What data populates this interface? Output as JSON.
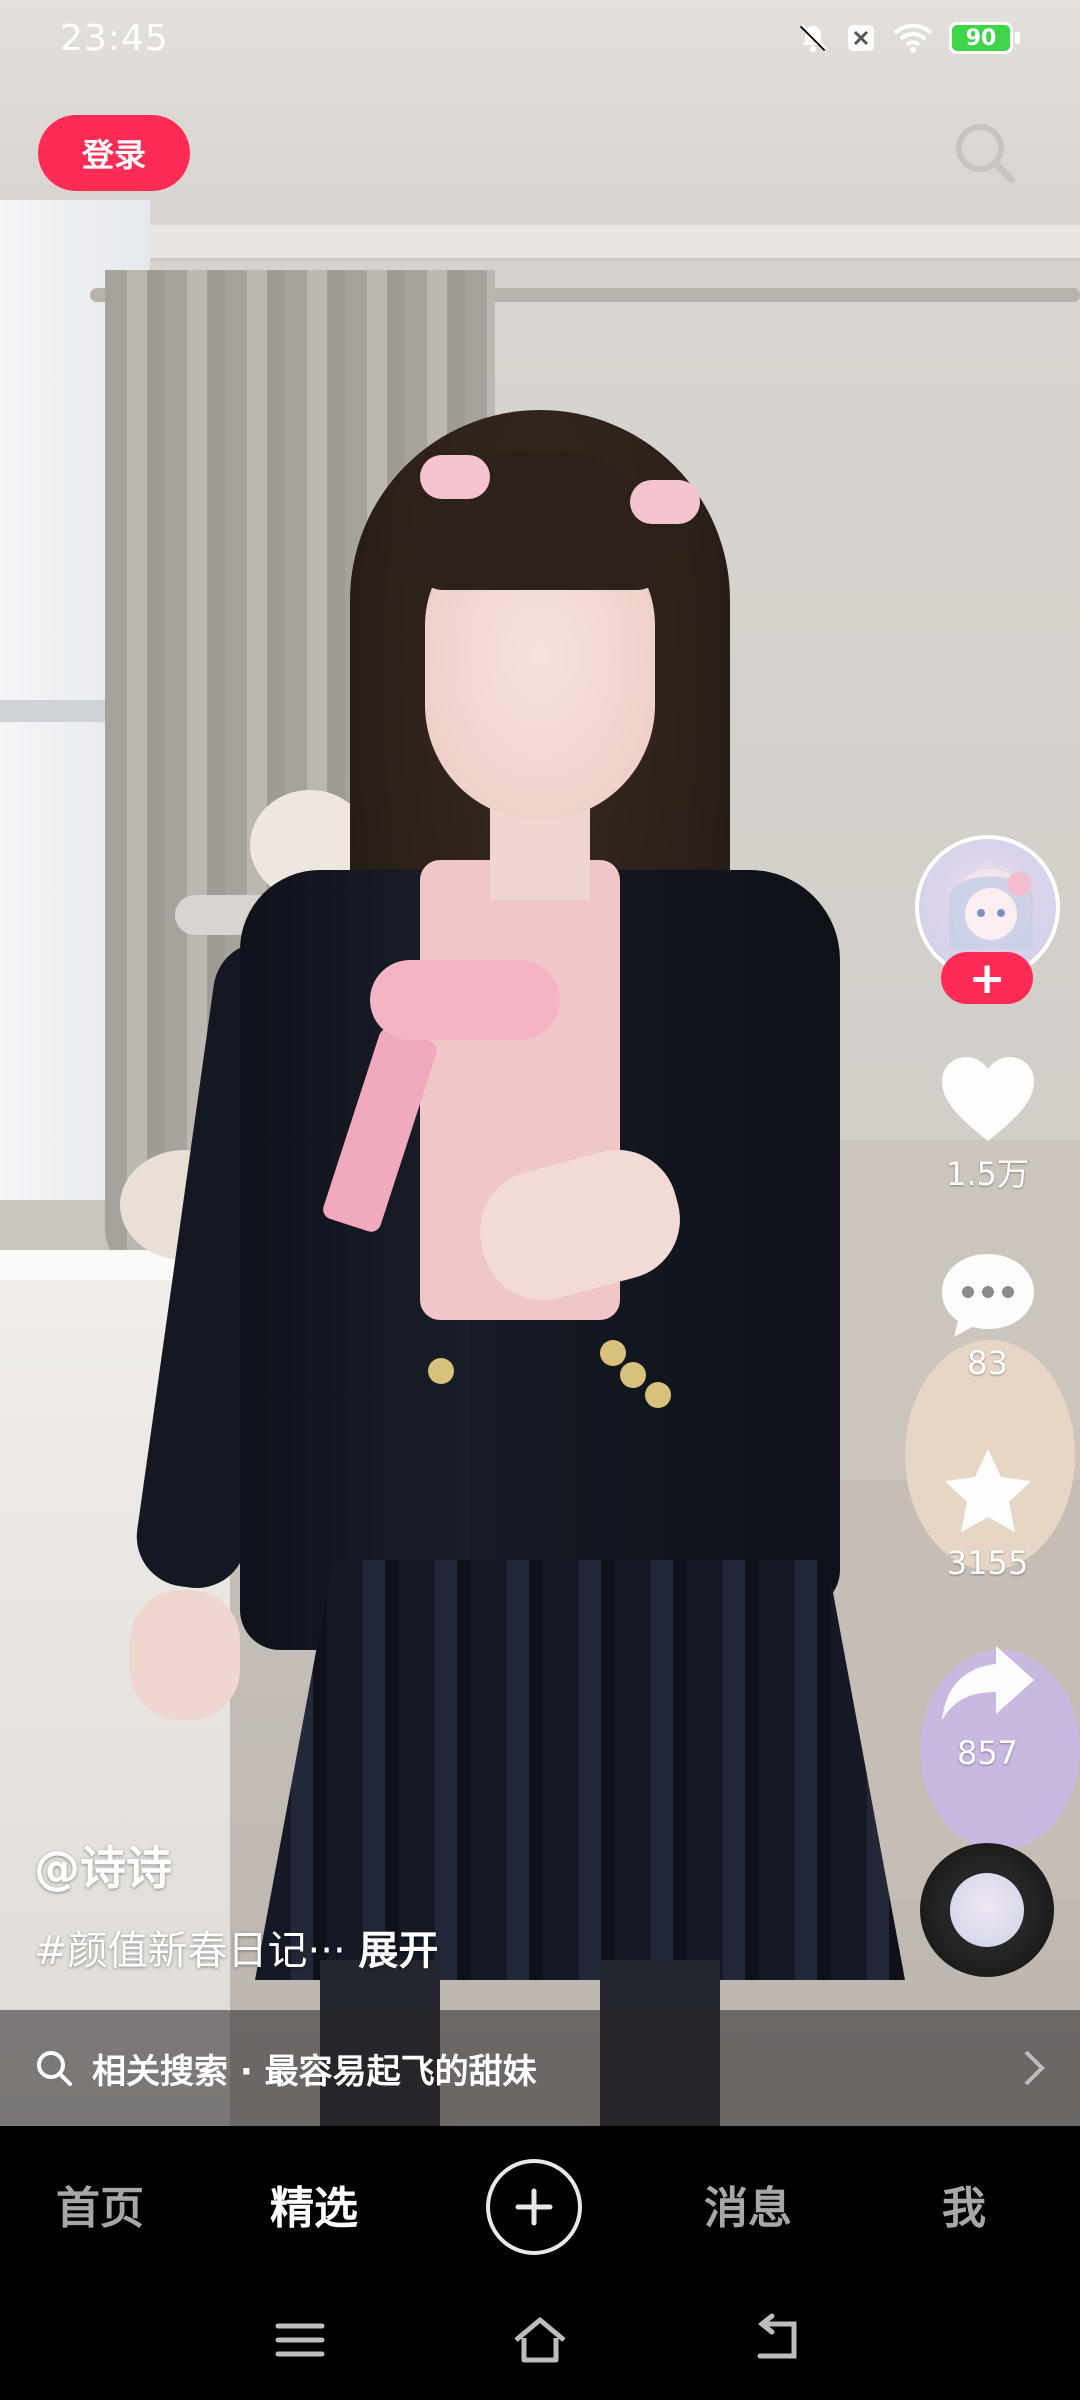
{
  "status_bar": {
    "time": "23:45",
    "battery": "90",
    "icons": [
      "mute-icon",
      "close-box-icon",
      "wifi-icon",
      "battery-icon"
    ]
  },
  "top": {
    "login_label": "登录",
    "search_icon": "search-icon"
  },
  "video": {
    "author": "@诗诗",
    "description": "#颜值新春日记···",
    "expand_label": "展开"
  },
  "actions": {
    "follow_label": "+",
    "likes": "1.5万",
    "comments": "83",
    "favorites": "3155",
    "shares": "857"
  },
  "related_search": {
    "text": "相关搜索 · 最容易起飞的甜妹"
  },
  "nav": {
    "home": "首页",
    "featured": "精选",
    "add": "+",
    "messages": "消息",
    "me": "我"
  },
  "colors": {
    "accent": "#fe2c55",
    "battery": "#3fd44a",
    "nav_bg": "#000000"
  }
}
